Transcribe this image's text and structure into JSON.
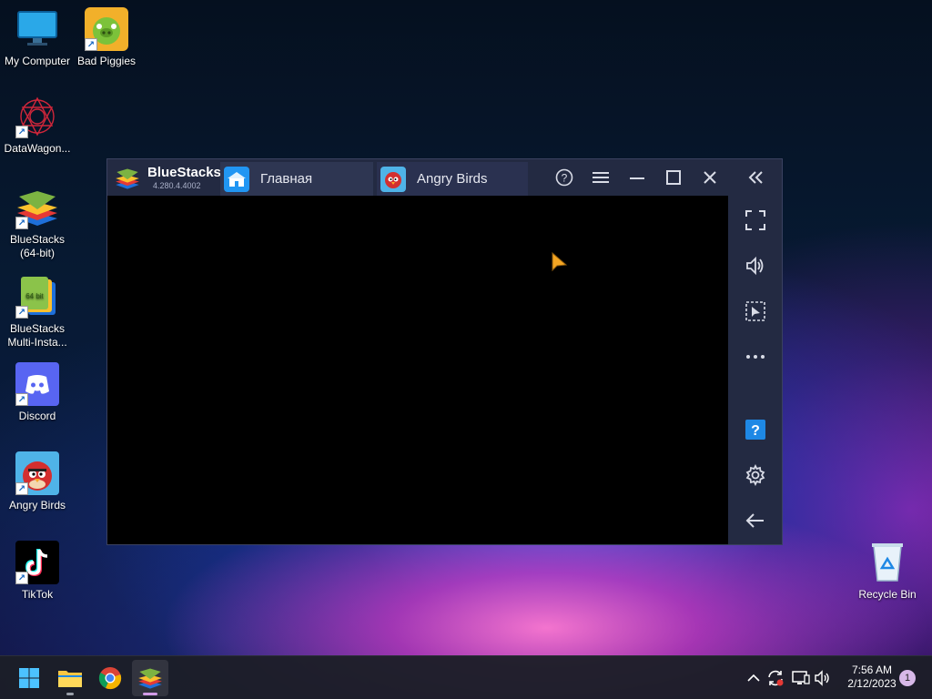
{
  "desktop": {
    "icons": [
      {
        "label": "My Computer",
        "icon": "monitor-icon"
      },
      {
        "label": "Bad Piggies",
        "icon": "bad-piggies-icon"
      },
      {
        "label": "DataWagon...",
        "icon": "datawagon-icon"
      },
      {
        "label": "BlueStacks\n(64-bit)",
        "icon": "bluestacks-icon"
      },
      {
        "label": "BlueStacks\nMulti-Insta...",
        "icon": "bluestacks-multi-icon"
      },
      {
        "label": "Discord",
        "icon": "discord-icon"
      },
      {
        "label": "Angry Birds",
        "icon": "angry-birds-icon"
      },
      {
        "label": "TikTok",
        "icon": "tiktok-icon"
      },
      {
        "label": "Recycle Bin",
        "icon": "recycle-bin-icon"
      }
    ]
  },
  "bluestacks": {
    "brand": "BlueStacks",
    "version": "4.280.4.4002",
    "tabs": [
      {
        "label": "Главная",
        "icon": "home-icon"
      },
      {
        "label": "Angry Birds",
        "icon": "angry-birds-icon"
      }
    ],
    "titlebar_buttons": [
      "help-icon",
      "menu-icon",
      "minimize-icon",
      "maximize-icon",
      "close-icon",
      "collapse-sidebar-icon"
    ],
    "sidebar_buttons": [
      "fullscreen-icon",
      "volume-icon",
      "select-cursor-icon",
      "more-icon",
      "help-icon",
      "settings-icon",
      "back-arrow-icon"
    ]
  },
  "taskbar": {
    "apps": [
      "windows-start-icon",
      "file-explorer-icon",
      "chrome-icon",
      "bluestacks-icon"
    ],
    "tray": [
      "chevron-up-icon",
      "sync-icon",
      "network-icon",
      "volume-icon"
    ],
    "time": "7:56 AM",
    "date": "2/12/2023",
    "notification_count": "1"
  },
  "colors": {
    "window_bg": "#232a42",
    "screen_bg": "#000000",
    "accent": "#1e88e5"
  }
}
